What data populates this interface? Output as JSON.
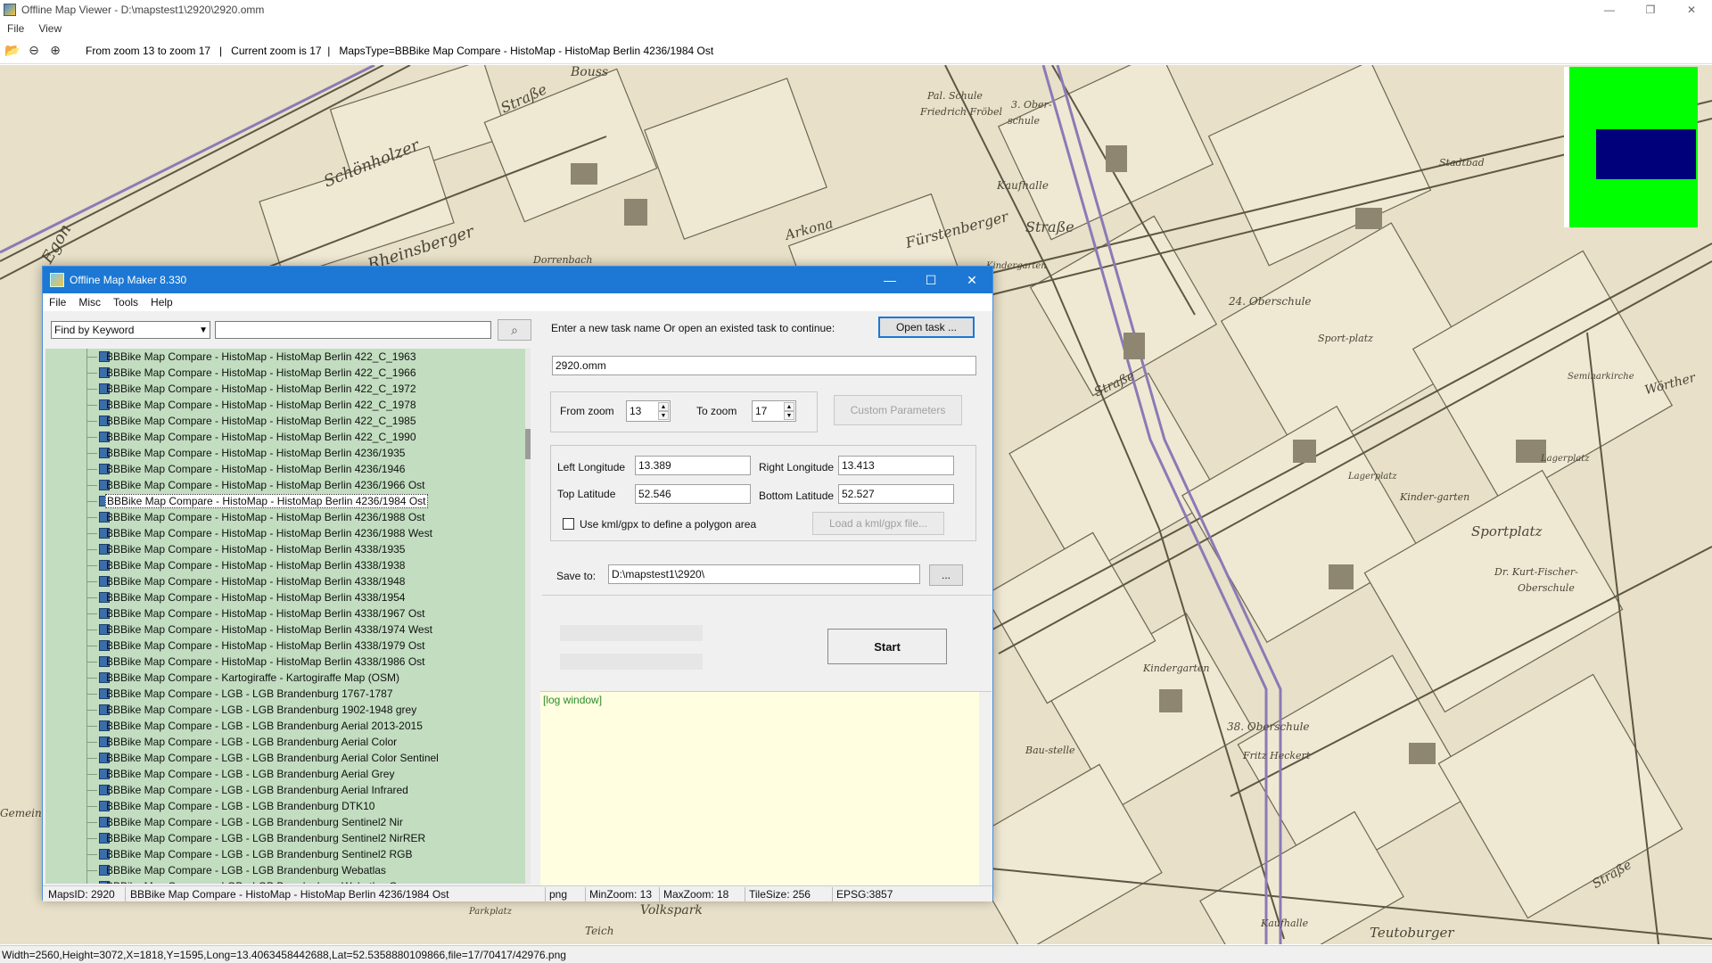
{
  "viewer": {
    "title": "Offline Map Viewer - D:\\mapstest1\\2920\\2920.omm",
    "menu": [
      "File",
      "View"
    ],
    "toolbar_text": "From zoom 13 to zoom 17   |   Current zoom is 17  |   MapsType=BBBike Map Compare - HistoMap - HistoMap Berlin 4236/1984 Ost",
    "status": "Width=2560,Height=3072,X=1818,Y=1595,Long=13.4063458442688,Lat=52.5358880109866,file=17/70417/42976.png",
    "window_controls": [
      "minimize",
      "restore",
      "close"
    ]
  },
  "map": {
    "labels": [
      "Bouss",
      "Straße",
      "Schönholzer",
      "Egon",
      "Rheinsberger",
      "Dorrenbach",
      "Pal. Schule",
      "Friedrich Fröbel",
      "3. Ober-",
      "schule",
      "Kaufhalle",
      "Arkona",
      "Fürstenberger",
      "Straße",
      "Stadtbad",
      "Kindergarten",
      "24. Oberschule",
      "Sport-platz",
      "Seminarkirche",
      "Wörther",
      "Lagerplatz",
      "Kinder-garten",
      "Sportplatz",
      "Dr. Kurt-Fischer-",
      "Oberschule",
      "Lagerplatz",
      "Straße",
      "Kindergarten",
      "38. Oberschule",
      "Fritz Heckert",
      "Bau-stelle",
      "Volkspark",
      "Teich",
      "Parkplatz",
      "Kaufhalle",
      "Teutoburger",
      "Straße",
      "Gemeinde"
    ],
    "minimap_colors": {
      "background": "#00ff00",
      "viewport": "#00007a"
    }
  },
  "dialog": {
    "title": "Offline Map Maker 8.330",
    "menu": [
      "File",
      "Misc",
      "Tools",
      "Help"
    ],
    "keyword_select": "Find by Keyword",
    "search_value": "",
    "tree_items": [
      "BBBike Map Compare - HistoMap - HistoMap Berlin 422_C_1963",
      "BBBike Map Compare - HistoMap - HistoMap Berlin 422_C_1966",
      "BBBike Map Compare - HistoMap - HistoMap Berlin 422_C_1972",
      "BBBike Map Compare - HistoMap - HistoMap Berlin 422_C_1978",
      "BBBike Map Compare - HistoMap - HistoMap Berlin 422_C_1985",
      "BBBike Map Compare - HistoMap - HistoMap Berlin 422_C_1990",
      "BBBike Map Compare - HistoMap - HistoMap Berlin 4236/1935",
      "BBBike Map Compare - HistoMap - HistoMap Berlin 4236/1946",
      "BBBike Map Compare - HistoMap - HistoMap Berlin 4236/1966 Ost",
      "BBBike Map Compare - HistoMap - HistoMap Berlin 4236/1984 Ost",
      "BBBike Map Compare - HistoMap - HistoMap Berlin 4236/1988 Ost",
      "BBBike Map Compare - HistoMap - HistoMap Berlin 4236/1988 West",
      "BBBike Map Compare - HistoMap - HistoMap Berlin 4338/1935",
      "BBBike Map Compare - HistoMap - HistoMap Berlin 4338/1938",
      "BBBike Map Compare - HistoMap - HistoMap Berlin 4338/1948",
      "BBBike Map Compare - HistoMap - HistoMap Berlin 4338/1954",
      "BBBike Map Compare - HistoMap - HistoMap Berlin 4338/1967 Ost",
      "BBBike Map Compare - HistoMap - HistoMap Berlin 4338/1974 West",
      "BBBike Map Compare - HistoMap - HistoMap Berlin 4338/1979 Ost",
      "BBBike Map Compare - HistoMap - HistoMap Berlin 4338/1986 Ost",
      "BBBike Map Compare - Kartogiraffe - Kartogiraffe Map (OSM)",
      "BBBike Map Compare - LGB - LGB Brandenburg 1767-1787",
      "BBBike Map Compare - LGB - LGB Brandenburg 1902-1948 grey",
      "BBBike Map Compare - LGB - LGB Brandenburg Aerial 2013-2015",
      "BBBike Map Compare - LGB - LGB Brandenburg Aerial Color",
      "BBBike Map Compare - LGB - LGB Brandenburg Aerial Color Sentinel",
      "BBBike Map Compare - LGB - LGB Brandenburg Aerial Grey",
      "BBBike Map Compare - LGB - LGB Brandenburg Aerial Infrared",
      "BBBike Map Compare - LGB - LGB Brandenburg DTK10",
      "BBBike Map Compare - LGB - LGB Brandenburg Sentinel2 Nir",
      "BBBike Map Compare - LGB - LGB Brandenburg Sentinel2 NirRER",
      "BBBike Map Compare - LGB - LGB Brandenburg Sentinel2 RGB",
      "BBBike Map Compare - LGB - LGB Brandenburg Webatlas",
      "BBBike Map Compare - LGB - LGB Brandenburg Webatlas Grey"
    ],
    "selected_item": "BBBike Map Compare - HistoMap - HistoMap Berlin 4236/1984 Ost",
    "task_prompt": "Enter a new task name Or open an existed task to continue:",
    "open_task_label": "Open task ...",
    "task_name": "2920.omm",
    "from_zoom_label": "From zoom",
    "from_zoom": "13",
    "to_zoom_label": "To zoom",
    "to_zoom": "17",
    "custom_params_label": "Custom Parameters",
    "left_lon_label": "Left Longitude",
    "left_lon": "13.389",
    "right_lon_label": "Right Longitude",
    "right_lon": "13.413",
    "top_lat_label": "Top Latitude",
    "top_lat": "52.546",
    "bottom_lat_label": "Bottom Latitude",
    "bottom_lat": "52.527",
    "kml_check_label": "Use kml/gpx to define a polygon area",
    "kml_checked": false,
    "load_kml_label": "Load a kml/gpx file...",
    "save_to_label": "Save to:",
    "save_to": "D:\\mapstest1\\2920\\",
    "browse_label": "...",
    "start_label": "Start",
    "log_text": "[log window]",
    "status": {
      "maps_id": "MapsID: 2920",
      "map_name": "BBBike Map Compare - HistoMap - HistoMap Berlin 4236/1984 Ost",
      "format": "png",
      "min_zoom": "MinZoom: 13",
      "max_zoom": "MaxZoom: 18",
      "tile_size": "TileSize: 256",
      "epsg": "EPSG:3857"
    }
  }
}
